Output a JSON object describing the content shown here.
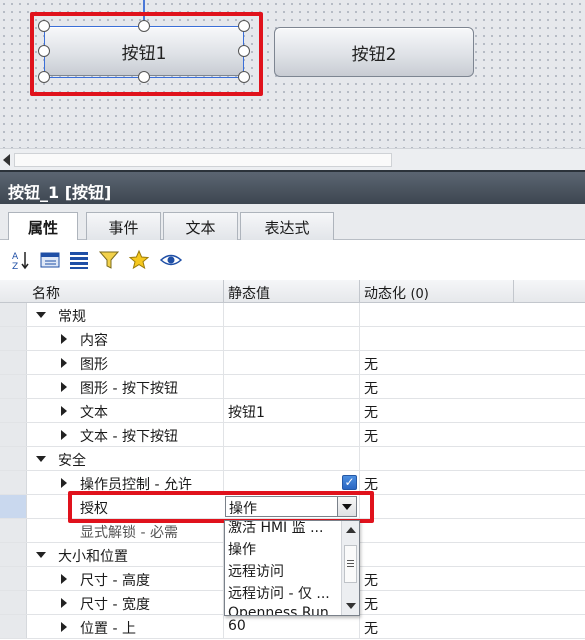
{
  "canvas": {
    "button1_label": "按钮1",
    "button2_label": "按钮2"
  },
  "inspector": {
    "title": "按钮_1 [按钮]",
    "tabs": [
      {
        "label": "属性"
      },
      {
        "label": "事件"
      },
      {
        "label": "文本"
      },
      {
        "label": "表达式"
      }
    ],
    "toolbar_icons": [
      "sort-az-icon",
      "category-view-icon",
      "list-view-icon",
      "filter-icon",
      "favorite-star-icon",
      "visibility-eye-icon"
    ]
  },
  "grid": {
    "columns": {
      "name": "名称",
      "static_value": "静态值",
      "dynamic": "动态化",
      "dynamic_count": "(0)"
    },
    "rows": [
      {
        "name": "常规",
        "value": "",
        "dyn": ""
      },
      {
        "name": "内容",
        "value": "",
        "dyn": ""
      },
      {
        "name": "图形",
        "value": "",
        "dyn": "无"
      },
      {
        "name": "图形 - 按下按钮",
        "value": "",
        "dyn": "无"
      },
      {
        "name": "文本",
        "value": "按钮1",
        "dyn": "无"
      },
      {
        "name": "文本 - 按下按钮",
        "value": "",
        "dyn": "无"
      },
      {
        "name": "安全",
        "value": "",
        "dyn": ""
      },
      {
        "name": "操作员控制 - 允许",
        "value": "",
        "dyn": "无"
      },
      {
        "name": "授权",
        "value": "操作",
        "dyn": ""
      },
      {
        "name": "显式解锁 - 必需",
        "value": "",
        "dyn": ""
      },
      {
        "name": "大小和位置",
        "value": "",
        "dyn": ""
      },
      {
        "name": "尺寸 - 高度",
        "value": "",
        "dyn": "无"
      },
      {
        "name": "尺寸 - 宽度",
        "value": "",
        "dyn": "无"
      },
      {
        "name": "位置 - 上",
        "value": "60",
        "dyn": "无"
      }
    ],
    "dropdown_options": [
      "激活 HMI 监 ...",
      "操作",
      "远程访问",
      "远程访问 - 仅 ...",
      "Openness Run ..."
    ]
  },
  "colors": {
    "highlight_red": "#e0121c",
    "selection_blue": "#3b6fd8",
    "header_dark": "#3d4650"
  }
}
